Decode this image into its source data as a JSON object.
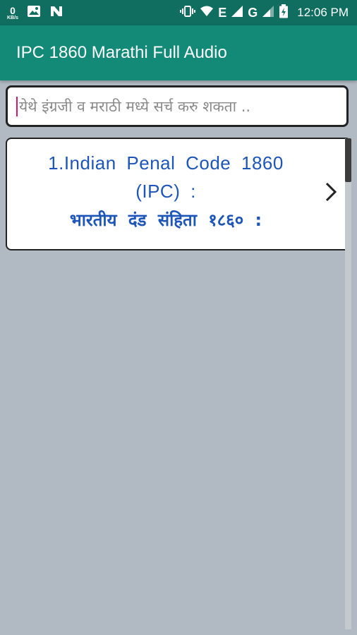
{
  "status_bar": {
    "net_speed_value": "0",
    "net_speed_unit": "KB/s",
    "network_label_e": "E",
    "network_label_g": "G",
    "time": "12:06 PM",
    "icons": [
      "image-icon",
      "n-icon",
      "vibrate-icon",
      "wifi-icon",
      "signal-icon",
      "signal-icon-2",
      "battery-icon"
    ]
  },
  "app_bar": {
    "title": "IPC 1860 Marathi Full Audio",
    "color": "#138a78"
  },
  "search": {
    "placeholder": "येथे इंग्रजी व मराठी मध्ये सर्च करु शकता ..",
    "value": ""
  },
  "list": {
    "items": [
      {
        "title": "1.Indian Penal Code 1860 (IPC) :",
        "subtitle": "भारतीय दंड संहिता १८६० :",
        "chevron_icon": "chevron-right-icon"
      }
    ]
  },
  "colors": {
    "accent": "#1d56b8",
    "background": "#b1bac3",
    "status_bar": "#0f6e5f"
  }
}
